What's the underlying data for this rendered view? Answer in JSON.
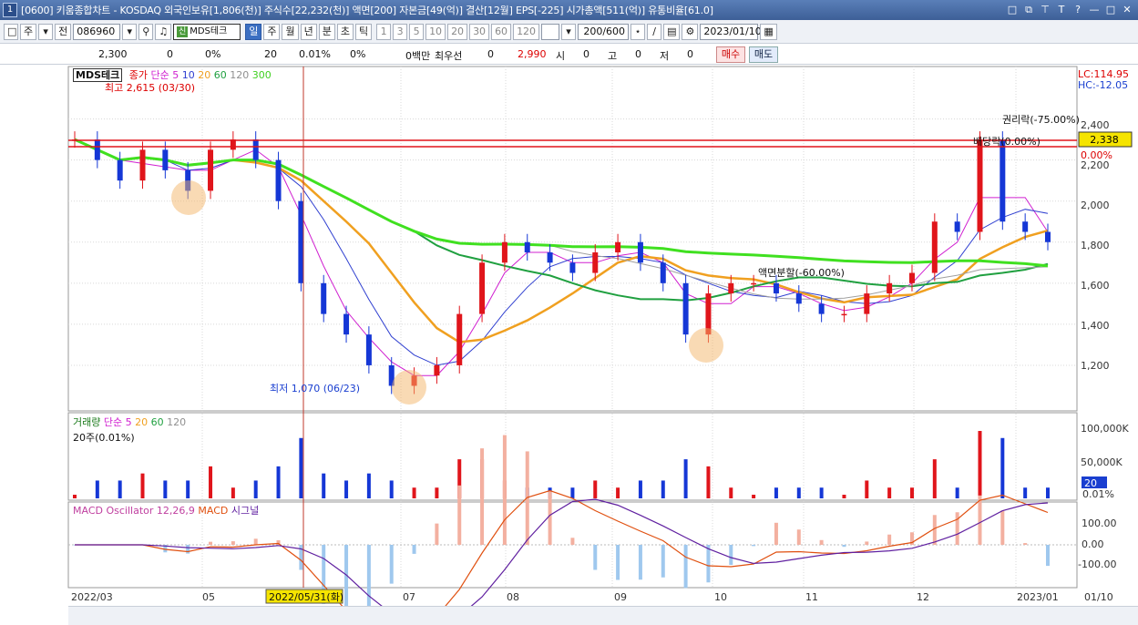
{
  "title_bar": {
    "number": "1",
    "text": "[0600] 키움종합차트 - KOSDAQ 외국인보유[1,806(천)] 주식수[22,232(천)] 액면[200] 자본금[49(억)] 결산[12월] EPS[-225] 시가총액[511(억)] 유통비율[61.0]",
    "controls": [
      "□",
      "⧉",
      "⊤",
      "T",
      "?",
      "—",
      "□",
      "✕"
    ]
  },
  "toolbar": {
    "mode1": "주",
    "mode2": "전",
    "code": "086960",
    "name": "MDS테크",
    "periods": [
      "일",
      "주",
      "월",
      "년",
      "분",
      "초",
      "틱"
    ],
    "selected_period": "일",
    "minutes": [
      "1",
      "3",
      "5",
      "10",
      "20",
      "30",
      "60",
      "120"
    ],
    "count": "200/600",
    "date": "2023/01/10"
  },
  "quote": {
    "price": "2,300",
    "change": "0",
    "change_pct": "0%",
    "volume": "20",
    "volume_pct": "0.01%",
    "ratio": "0%",
    "amount": "0백만",
    "best_label": "최우선",
    "best_val": "0",
    "upper": "2,990",
    "open_label": "시",
    "open_val": "0",
    "high_label": "고",
    "high_val": "0",
    "low_label": "저",
    "low_val": "0",
    "buy": "매수",
    "sell": "매도"
  },
  "price_panel": {
    "legend_name": "MDS테크",
    "legend_price": "종가",
    "legend_ma": "단순 5",
    "ma_periods": [
      "10",
      "20",
      "60",
      "120",
      "300"
    ],
    "high_note": "최고 2,615 (03/30)",
    "low_note": "최저 1,070 (06/23)",
    "split_note": "액면분할(-60.00%)",
    "rights_note": "권리락(-75.00%)",
    "dividend_note": "배당락(0.00%)",
    "lc": "LC:114.95",
    "hc": "HC:-12.05",
    "current_tag": "2,338",
    "tag_pct": "0.00%",
    "y_ticks": [
      "2,400",
      "2,200",
      "2,000",
      "1,800",
      "1,600",
      "1,400",
      "1,200"
    ],
    "colors": {
      "up": "#e0151b",
      "down": "#1537d6",
      "ma5": "#d020d0",
      "ma10": "#2f3fd0",
      "ma20": "#f0a020",
      "ma60": "#20a040",
      "ma120": "#a0a0a0",
      "ma300": "#40e020"
    }
  },
  "volume_panel": {
    "legend_name": "거래량",
    "legend_ma": "단순 5",
    "ma_periods": [
      "20",
      "60",
      "120"
    ],
    "sub_note": "20주(0.01%)",
    "y_ticks": [
      "100,000K",
      "50,000K"
    ],
    "current_tag": "20",
    "tag_pct": "0.01%"
  },
  "macd_panel": {
    "legend_osc": "MACD Oscillator 12,26,9",
    "legend_macd": "MACD",
    "legend_signal": "시그널",
    "y_ticks": [
      "100.00",
      "0.00",
      "-100.00"
    ]
  },
  "x_axis": {
    "labels": [
      "2022/03",
      "05",
      "07",
      "08",
      "09",
      "10",
      "11",
      "12",
      "2023/01",
      "01/10"
    ],
    "cursor_label": "2022/05/31(화)"
  },
  "chart_data": {
    "type": "candlestick",
    "title": "MDS테크",
    "y_range": [
      1000,
      2620
    ],
    "ma_labels": [
      "5",
      "10",
      "20",
      "60",
      "120",
      "300"
    ],
    "approx_closes": [
      2300,
      2200,
      2100,
      2250,
      2150,
      2050,
      2250,
      2300,
      2200,
      2000,
      1600,
      1450,
      1350,
      1200,
      1100,
      1150,
      1200,
      1450,
      1700,
      1800,
      1750,
      1700,
      1650,
      1750,
      1800,
      1700,
      1600,
      1350,
      1550,
      1600,
      1600,
      1550,
      1500,
      1450,
      1450,
      1550,
      1600,
      1650,
      1900,
      1850,
      2300,
      1900,
      1850,
      1800
    ]
  }
}
